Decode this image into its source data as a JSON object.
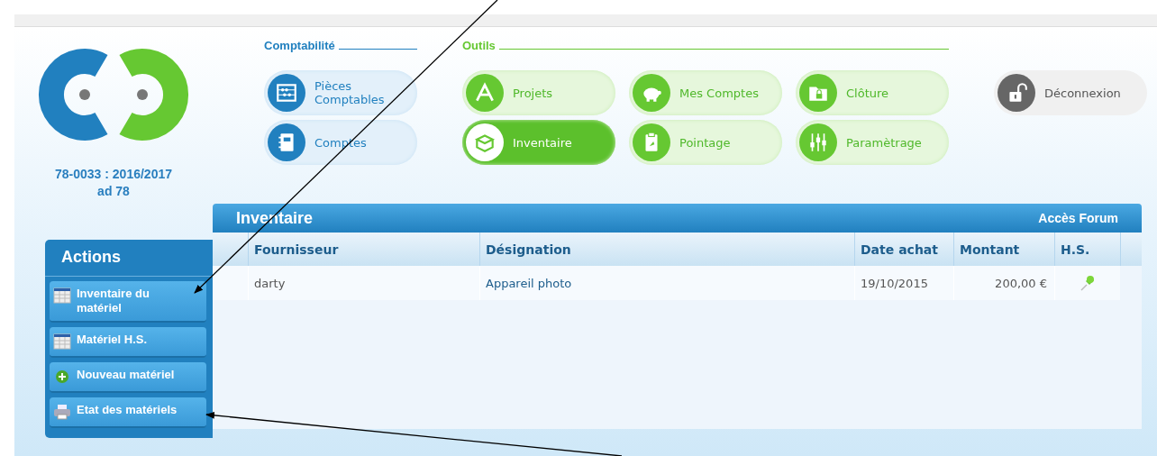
{
  "account": {
    "code": "78-0033 : 2016/2017",
    "name": "ad 78"
  },
  "nav_groups": [
    {
      "title": "Comptabilité",
      "kind": "accounting",
      "buttons": [
        {
          "label": "Pièces Comptables",
          "selected": false
        },
        {
          "label": "Comptes",
          "selected": false
        }
      ]
    },
    {
      "title": "Outils",
      "kind": "tools",
      "buttons": [
        {
          "label": "Projets",
          "selected": false
        },
        {
          "label": "Mes Comptes",
          "selected": false
        },
        {
          "label": "Clôture",
          "selected": false
        },
        {
          "label": "Inventaire",
          "selected": true
        },
        {
          "label": "Pointage",
          "selected": false
        },
        {
          "label": "Paramètrage",
          "selected": false
        }
      ]
    }
  ],
  "logout": {
    "label": "Déconnexion"
  },
  "actions": {
    "title": "Actions",
    "items": [
      {
        "label": "Inventaire du matériel",
        "kind": "table"
      },
      {
        "label": "Matériel H.S.",
        "kind": "table"
      },
      {
        "label": "Nouveau matériel",
        "kind": "add"
      },
      {
        "label": "Etat des matériels",
        "kind": "print"
      }
    ]
  },
  "panel": {
    "title": "Inventaire",
    "link": "Accès Forum"
  },
  "table": {
    "columns": [
      "Fournisseur",
      "Désignation",
      "Date achat",
      "Montant",
      "H.S."
    ],
    "rows": [
      {
        "cells": [
          "darty",
          "Appareil photo",
          "19/10/2015",
          "200,00 €"
        ],
        "hs": true
      }
    ]
  }
}
